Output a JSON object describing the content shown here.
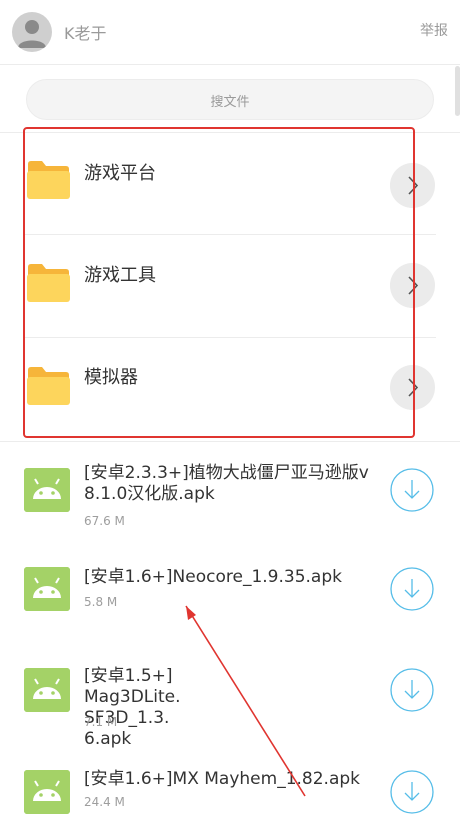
{
  "header": {
    "username": "K老于",
    "report_label": "举报"
  },
  "search": {
    "placeholder": "搜文件"
  },
  "folders": [
    {
      "label": "游戏平台",
      "icon": "folder-icon"
    },
    {
      "label": "游戏工具",
      "icon": "folder-icon"
    },
    {
      "label": "模拟器",
      "icon": "folder-icon"
    }
  ],
  "files": [
    {
      "name": "[安卓2.3.3+]植物大战僵尸亚马逊版v8.1.0汉化版.apk",
      "size": "67.6 M",
      "icon": "android-apk-icon"
    },
    {
      "name": "[安卓1.6+]Neocore_1.9.35.apk",
      "size": "5.8 M",
      "icon": "android-apk-icon"
    },
    {
      "name": "[安卓1.5+]Mag3DLite.SF3D_1.3.6.apk",
      "size": "7.1 M",
      "icon": "android-apk-icon"
    },
    {
      "name": "[安卓1.6+]MX Mayhem_1.82.apk",
      "size": "24.4 M",
      "icon": "android-apk-icon"
    }
  ],
  "colors": {
    "folder": "#fdd55c",
    "folder_back": "#f6b53a",
    "apk": "#a4d267",
    "download": "#56bde8",
    "highlight": "#e03530"
  }
}
